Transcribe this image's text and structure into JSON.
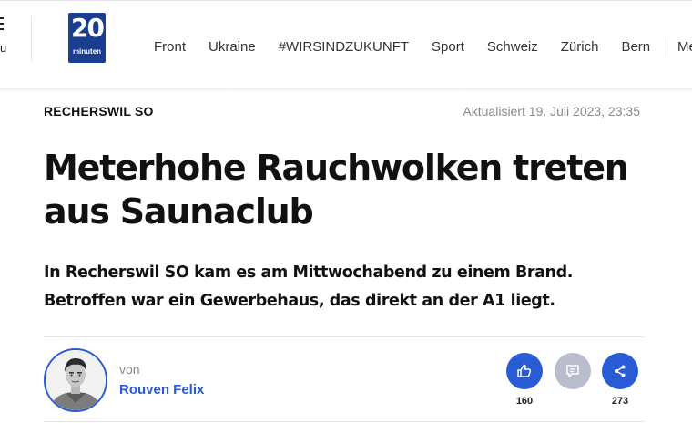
{
  "nav": {
    "menu_label": "u",
    "logo": {
      "big": "20",
      "small": "minuten"
    },
    "links": [
      "Front",
      "Ukraine",
      "#WIRSINDZUKUNFT",
      "Sport",
      "Schweiz",
      "Zürich",
      "Bern"
    ],
    "more": "Me"
  },
  "article": {
    "kicker": "RECHERSWIL SO",
    "updated": "Aktualisiert 19. Juli 2023, 23:35",
    "headline_line1": "Meterhohe Rauchwolken treten",
    "headline_line2": "aus Saunaclub",
    "lead_line1": "In Recherswil SO kam es am Mittwochabend zu einem Brand.",
    "lead_line2": "Betroffen war ein Gewerbehaus, das direkt an der A1 liegt."
  },
  "byline": {
    "prefix": "von",
    "author": "Rouven Felix"
  },
  "actions": {
    "like_count": "160",
    "share_count": "273",
    "like_icon": "thumbs-up-down-icon",
    "comment_icon": "comment-icon",
    "share_icon": "share-icon"
  },
  "colors": {
    "brand_blue": "#2a5bd7",
    "logo_blue": "#1a3d8f",
    "muted_grey": "#8a8a8a",
    "comment_grey": "#b9bdcc"
  }
}
